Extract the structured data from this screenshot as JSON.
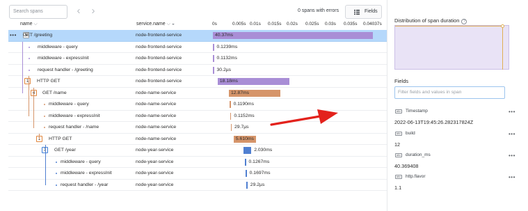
{
  "toolbar": {
    "search_placeholder": "Search spans",
    "prev_icon": "chevron-left-icon",
    "next_icon": "chevron-right-icon",
    "errors_text": "0 spans with errors",
    "fields_button": "Fields"
  },
  "columns": {
    "name": "name",
    "service": "service.name",
    "ticks": [
      "0s",
      "0.005s",
      "0.01s",
      "0.015s",
      "0.02s",
      "0.025s",
      "0.03s",
      "0.035s",
      "0.04037s"
    ]
  },
  "colors": {
    "frontend": "#a98ed6",
    "name_service": "#d6956a",
    "year_service": "#4f7fd1",
    "selected_row": "#b5d8fb",
    "annotation_arrow": "#e3221c"
  },
  "spans": [
    {
      "name": "GET /greeting",
      "service": "node-frontend-service",
      "duration": "40.37ms",
      "count": "5",
      "start_fraction": 0.0,
      "duration_fraction": 1.0,
      "selected": true
    },
    {
      "name": "middleware - query",
      "service": "node-frontend-service",
      "duration": "0.1239ms",
      "count": "",
      "start_fraction": 0.0,
      "duration_fraction": 0.003
    },
    {
      "name": "middleware - expressInit",
      "service": "node-frontend-service",
      "duration": "0.1132ms",
      "count": "",
      "start_fraction": 0.0,
      "duration_fraction": 0.0028
    },
    {
      "name": "request handler - /greeting",
      "service": "node-frontend-service",
      "duration": "30.2µs",
      "count": "",
      "start_fraction": 0.0,
      "duration_fraction": 0.0008
    },
    {
      "name": "HTTP GET",
      "service": "node-frontend-service",
      "duration": "18.18ms",
      "count": "1",
      "start_fraction": 0.03,
      "duration_fraction": 0.45
    },
    {
      "name": "GET /name",
      "service": "node-name-service",
      "duration": "12.87ms",
      "count": "4",
      "start_fraction": 0.1,
      "duration_fraction": 0.32
    },
    {
      "name": "middleware - query",
      "service": "node-name-service",
      "duration": "0.1190ms",
      "count": "",
      "start_fraction": 0.105,
      "duration_fraction": 0.003
    },
    {
      "name": "middleware - expressInit",
      "service": "node-name-service",
      "duration": "0.1152ms",
      "count": "",
      "start_fraction": 0.108,
      "duration_fraction": 0.003
    },
    {
      "name": "request handler - /name",
      "service": "node-name-service",
      "duration": "29.7µs",
      "count": "",
      "start_fraction": 0.111,
      "duration_fraction": 0.0008
    },
    {
      "name": "HTTP GET",
      "service": "node-name-service",
      "duration": "5.610ms",
      "count": "1",
      "start_fraction": 0.13,
      "duration_fraction": 0.139
    },
    {
      "name": "GET /year",
      "service": "node-year-service",
      "duration": "2.030ms",
      "count": "3",
      "start_fraction": 0.19,
      "duration_fraction": 0.05
    },
    {
      "name": "middleware - query",
      "service": "node-year-service",
      "duration": "0.1267ms",
      "count": "",
      "start_fraction": 0.2,
      "duration_fraction": 0.003
    },
    {
      "name": "middleware - expressInit",
      "service": "node-year-service",
      "duration": "0.1697ms",
      "count": "",
      "start_fraction": 0.205,
      "duration_fraction": 0.004
    },
    {
      "name": "request handler - /year",
      "service": "node-year-service",
      "duration": "29.2µs",
      "count": "",
      "start_fraction": 0.21,
      "duration_fraction": 0.0008
    }
  ],
  "side": {
    "distribution_title": "Distribution of span duration",
    "help_icon": "question-circle-icon",
    "fields_title": "Fields",
    "filter_placeholder": "Filter fields and values in span",
    "fields": [
      {
        "name": "Timestamp",
        "value": "2022-06-13T19:45:26.282317824Z"
      },
      {
        "name": "build",
        "value": "12"
      },
      {
        "name": "duration_ms",
        "value": "40.369408"
      },
      {
        "name": "http.flavor",
        "value": "1.1"
      }
    ]
  }
}
